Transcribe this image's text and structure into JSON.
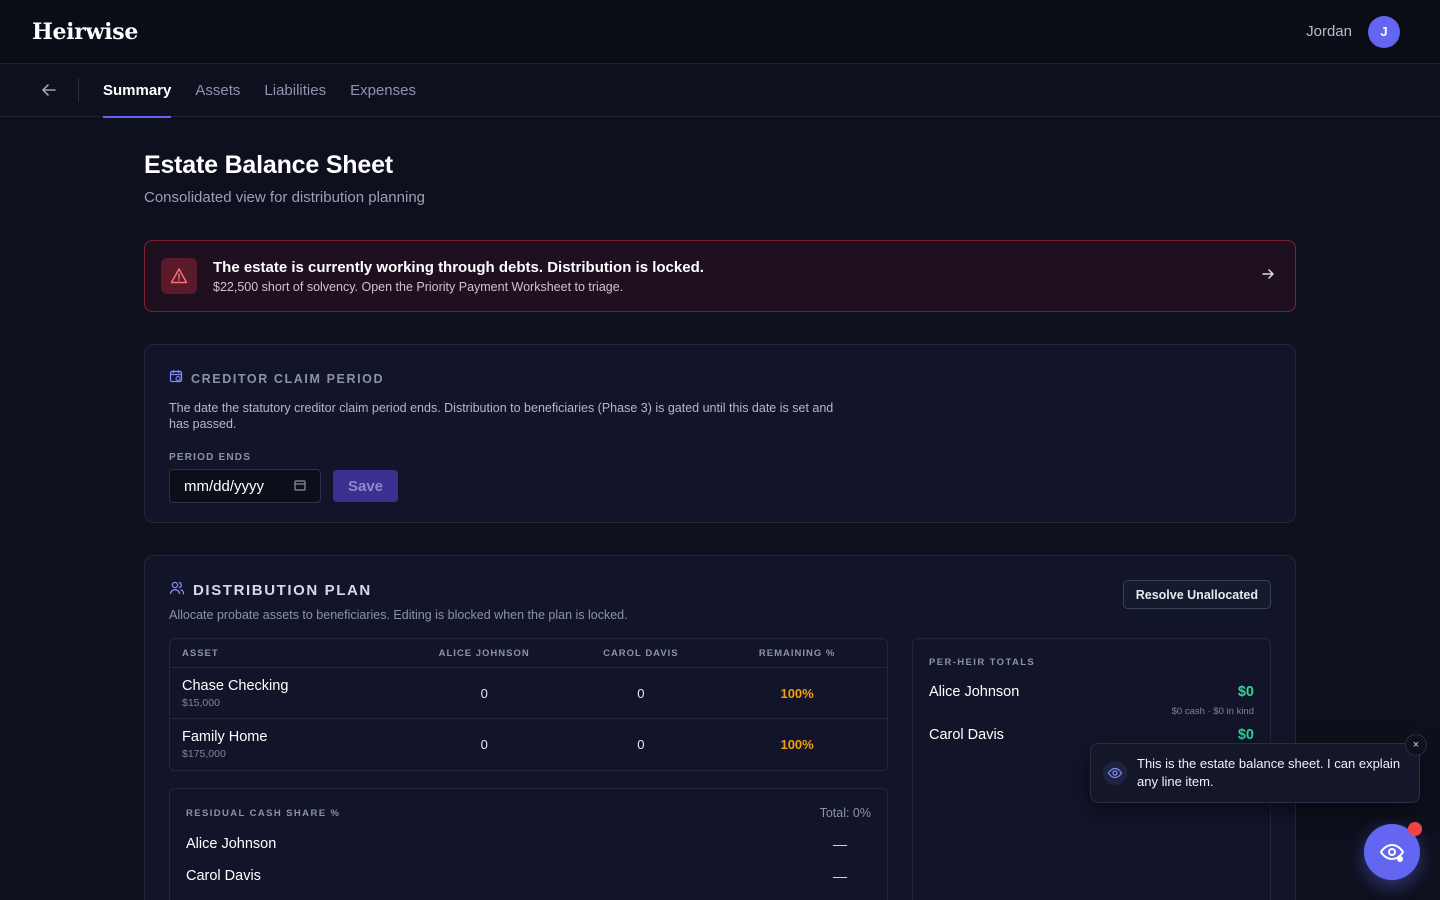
{
  "app": {
    "brand": "Heirwise"
  },
  "user": {
    "name": "Jordan",
    "initial": "J"
  },
  "tabs": [
    {
      "label": "Summary",
      "active": true
    },
    {
      "label": "Assets",
      "active": false
    },
    {
      "label": "Liabilities",
      "active": false
    },
    {
      "label": "Expenses",
      "active": false
    }
  ],
  "page": {
    "title": "Estate Balance Sheet",
    "subtitle": "Consolidated view for distribution planning"
  },
  "alert": {
    "title": "The estate is currently working through debts. Distribution is locked.",
    "subtitle": "$22,500 short of solvency. Open the Priority Payment Worksheet to triage."
  },
  "claim_period": {
    "title": "CREDITOR CLAIM PERIOD",
    "description": "The date the statutory creditor claim period ends. Distribution to beneficiaries (Phase 3) is gated until this date is set and has passed.",
    "field_label": "PERIOD ENDS",
    "date_placeholder": "mm/dd/yyyy",
    "save_label": "Save"
  },
  "distribution": {
    "title": "DISTRIBUTION PLAN",
    "subtitle": "Allocate probate assets to beneficiaries. Editing is blocked when the plan is locked.",
    "resolve_label": "Resolve Unallocated",
    "columns": [
      "ASSET",
      "ALICE JOHNSON",
      "CAROL DAVIS",
      "REMAINING %"
    ],
    "rows": [
      {
        "asset": "Chase Checking",
        "value": "$15,000",
        "alice": "0",
        "carol": "0",
        "remaining": "100%"
      },
      {
        "asset": "Family Home",
        "value": "$175,000",
        "alice": "0",
        "carol": "0",
        "remaining": "100%"
      }
    ],
    "residual": {
      "label": "RESIDUAL CASH SHARE %",
      "total": "Total: 0%",
      "rows": [
        {
          "name": "Alice Johnson",
          "value": "—"
        },
        {
          "name": "Carol Davis",
          "value": "—"
        }
      ]
    },
    "per_heir": {
      "label": "PER-HEIR TOTALS",
      "rows": [
        {
          "name": "Alice Johnson",
          "amount": "$0",
          "detail": "$0 cash · $0 in kind"
        },
        {
          "name": "Carol Davis",
          "amount": "$0"
        }
      ]
    }
  },
  "assistant": {
    "message": "This is the estate balance sheet. I can explain any line item.",
    "close_label": "×"
  },
  "colors": {
    "accent": "#6366f1",
    "warning": "#f59e0b",
    "positive": "#34d399",
    "danger": "#ef4444"
  }
}
